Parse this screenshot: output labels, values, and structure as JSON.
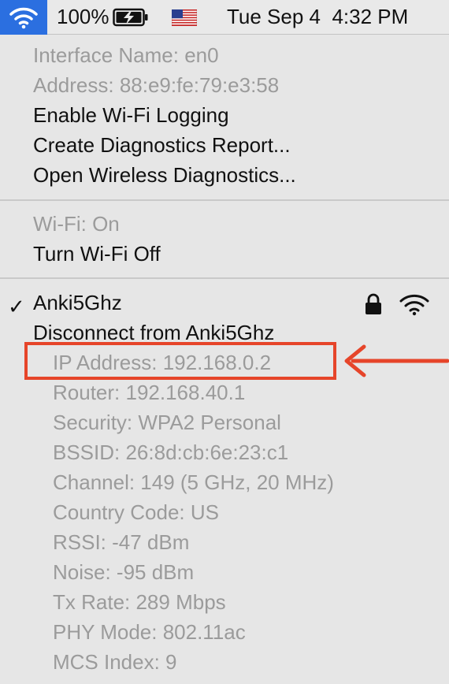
{
  "menubar": {
    "battery_percent": "100%",
    "clock": "Tue Sep 4  4:32 PM",
    "icons": [
      "wifi-icon",
      "battery-charging-icon",
      "us-flag-icon"
    ]
  },
  "interface_section": {
    "interface_name": "Interface Name: en0",
    "address": "Address: 88:e9:fe:79:e3:58",
    "enable_logging": "Enable Wi-Fi Logging",
    "create_report": "Create Diagnostics Report...",
    "open_diagnostics": "Open Wireless Diagnostics..."
  },
  "power_section": {
    "status": "Wi-Fi: On",
    "toggle": "Turn Wi-Fi Off"
  },
  "network": {
    "checkmark": "✓",
    "name": "Anki5Ghz",
    "disconnect": "Disconnect from Anki5Ghz",
    "details": [
      "IP Address: 192.168.0.2",
      "Router: 192.168.40.1",
      "Security: WPA2 Personal",
      "BSSID: 26:8d:cb:6e:23:c1",
      "Channel: 149 (5 GHz, 20 MHz)",
      "Country Code: US",
      "RSSI: -47 dBm",
      "Noise: -95 dBm",
      "Tx Rate: 289 Mbps",
      "PHY Mode: 802.11ac",
      "MCS Index: 9"
    ]
  },
  "annotation": {
    "color": "#e6452a",
    "icon": "red-arrow-icon"
  },
  "colors": {
    "menubar_accent": "#2b6fe0",
    "menu_background": "#e6e6e6",
    "disabled_text": "#9b9b9b"
  }
}
